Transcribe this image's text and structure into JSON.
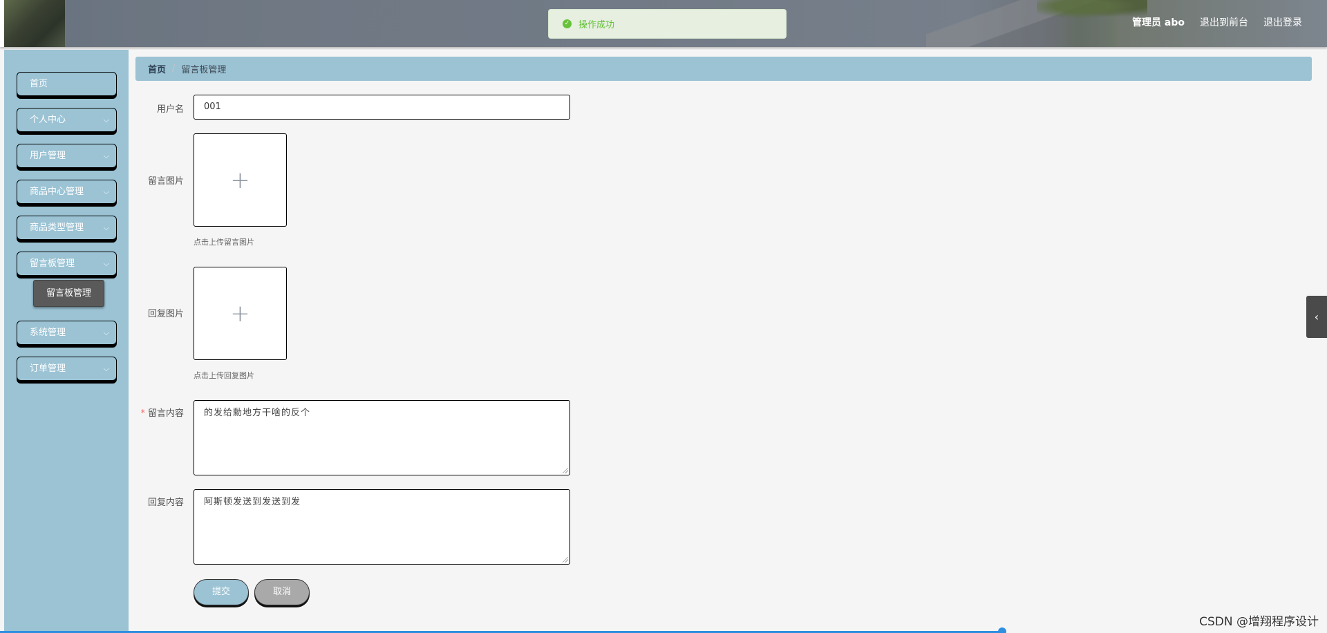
{
  "header": {
    "toast_message": "操作成功",
    "admin_label": "管理员 abo",
    "back_to_front": "退出到前台",
    "logout": "退出登录"
  },
  "sidebar": {
    "items": [
      {
        "label": "首页"
      },
      {
        "label": "个人中心"
      },
      {
        "label": "用户管理"
      },
      {
        "label": "商品中心管理"
      },
      {
        "label": "商品类型管理"
      },
      {
        "label": "留言板管理"
      },
      {
        "label": "系统管理"
      },
      {
        "label": "订单管理"
      }
    ],
    "active_sub": "留言板管理"
  },
  "breadcrumb": {
    "home": "首页",
    "current": "留言板管理"
  },
  "form": {
    "username_label": "用户名",
    "username_value": "001",
    "image_label": "留言图片",
    "image_tip": "点击上传留言图片",
    "reply_image_label": "回复图片",
    "reply_image_tip": "点击上传回复图片",
    "content_label": "留言内容",
    "content_value": "的发给勳地方干啥的反个",
    "reply_label": "回复内容",
    "reply_value": "阿斯顿发送到发送到发",
    "submit": "提交",
    "cancel": "取消"
  },
  "watermark": "CSDN @增翔程序设计",
  "colors": {
    "sidebar_bg": "#9bc3d4",
    "submenu_bg": "#5a5a5a",
    "success": "#67c23a",
    "required": "#f56c6c"
  }
}
